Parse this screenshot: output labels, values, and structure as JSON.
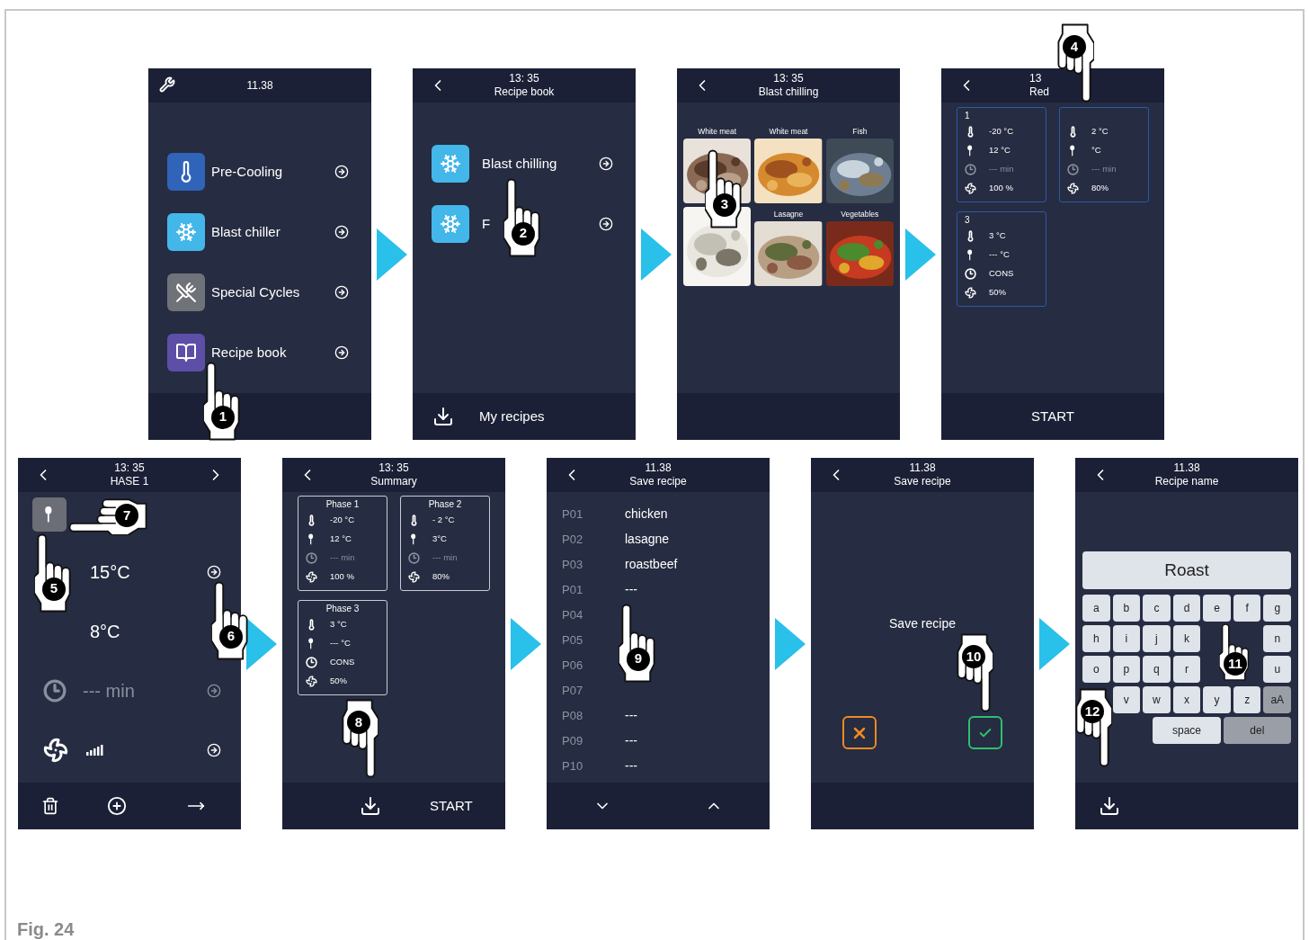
{
  "screens": [
    {
      "kind": "menu",
      "header": {
        "time": "11.38"
      },
      "items": [
        {
          "kind": "precooling",
          "label": "Pre-Cooling"
        },
        {
          "kind": "blast",
          "label": "Blast chiller"
        },
        {
          "kind": "special",
          "label": "Special Cycles"
        },
        {
          "kind": "book",
          "label": "Recipe book"
        }
      ],
      "steps": [
        {
          "number": "1",
          "kind": "up"
        }
      ]
    },
    {
      "kind": "recipe_book",
      "header": {
        "time": "13: 35",
        "title": "Recipe book"
      },
      "items": [
        {
          "kind": "blast",
          "label": "Blast chilling"
        },
        {
          "kind": "blast",
          "label": "F"
        }
      ],
      "footer": {
        "label": "My recipes"
      },
      "steps": [
        {
          "number": "2",
          "kind": "up"
        }
      ]
    },
    {
      "kind": "food_grid",
      "header": {
        "time": "13: 35",
        "title": "Blast chilling"
      },
      "tiles": [
        {
          "label": "White meat"
        },
        {
          "label": "White meat"
        },
        {
          "label": "Fish"
        },
        {
          "kind": "covered"
        },
        {
          "label": "Lasagne"
        },
        {
          "label": "Vegetables"
        }
      ],
      "steps": [
        {
          "number": "3",
          "kind": "up"
        }
      ]
    },
    {
      "kind": "phases",
      "header": {
        "time": "13",
        "title": "Red"
      },
      "cards": [
        {
          "title": "1",
          "rows": [
            {
              "kind": "temp",
              "value": "-20 °C",
              "disabled": false
            },
            {
              "kind": "probe",
              "value": "12 °C",
              "disabled": false
            },
            {
              "kind": "time",
              "value": "--- min",
              "disabled": true
            },
            {
              "kind": "fan",
              "value": "100 %",
              "disabled": false
            }
          ]
        },
        {
          "rows": [
            {
              "kind": "temp",
              "value": "2 °C",
              "disabled": false
            },
            {
              "kind": "probe",
              "value": "°C",
              "disabled": false
            },
            {
              "kind": "time",
              "value": "--- min",
              "disabled": true
            },
            {
              "kind": "fan",
              "value": "80%",
              "disabled": false
            }
          ]
        },
        {
          "title": "3",
          "rows": [
            {
              "kind": "temp",
              "value": "3 °C",
              "disabled": false
            },
            {
              "kind": "probe",
              "value": "--- °C",
              "disabled": false
            },
            {
              "kind": "time",
              "value": "CONS",
              "disabled": false
            },
            {
              "kind": "fan",
              "value": "50%",
              "disabled": false
            }
          ]
        }
      ],
      "footer": {
        "label": "START"
      },
      "steps": [
        {
          "number": "4",
          "kind": "down"
        }
      ]
    },
    {
      "kind": "phase_edit",
      "header": {
        "time": "13: 35",
        "title": "HASE 1"
      },
      "rows": [
        {
          "kind": "probe_tile",
          "selected": true
        },
        {
          "kind": "value",
          "value": "15°C",
          "arrow": true,
          "disabled": false
        },
        {
          "kind": "value",
          "value": "8°C",
          "arrow": false,
          "disabled": false
        },
        {
          "kind": "time",
          "value": "--- min",
          "arrow": true,
          "disabled": true
        },
        {
          "kind": "fan",
          "arrow": true,
          "disabled": false
        }
      ],
      "steps": [
        {
          "number": "5",
          "kind": "up"
        },
        {
          "number": "6",
          "kind": "up"
        },
        {
          "number": "7",
          "kind": "left"
        }
      ]
    },
    {
      "kind": "summary",
      "header": {
        "time": "13: 35",
        "title": "Summary"
      },
      "cards": [
        {
          "title": "Phase 1",
          "rows": [
            {
              "kind": "temp",
              "value": "-20 °C",
              "disabled": false
            },
            {
              "kind": "probe",
              "value": "12 °C",
              "disabled": false
            },
            {
              "kind": "time",
              "value": "--- min",
              "disabled": true
            },
            {
              "kind": "fan",
              "value": "100 %",
              "disabled": false
            }
          ]
        },
        {
          "title": "Phase 2",
          "rows": [
            {
              "kind": "temp",
              "value": "- 2 °C",
              "disabled": false
            },
            {
              "kind": "probe",
              "value": "3°C",
              "disabled": false
            },
            {
              "kind": "time",
              "value": "--- min",
              "disabled": true
            },
            {
              "kind": "fan",
              "value": "80%",
              "disabled": false
            }
          ]
        },
        {
          "title": "Phase 3",
          "rows": [
            {
              "kind": "temp",
              "value": "3 °C",
              "disabled": false
            },
            {
              "kind": "probe",
              "value": "--- °C",
              "disabled": false
            },
            {
              "kind": "time",
              "value": "CONS",
              "disabled": false
            },
            {
              "kind": "fan",
              "value": "50%",
              "disabled": false
            }
          ]
        }
      ],
      "footer": {
        "label": "START"
      },
      "steps": [
        {
          "number": "8",
          "kind": "down"
        }
      ]
    },
    {
      "kind": "recipe_list",
      "header": {
        "time": "11.38",
        "title": "Save recipe"
      },
      "rows": [
        {
          "code": "P01",
          "value": "chicken"
        },
        {
          "code": "P02",
          "value": "lasagne"
        },
        {
          "code": "P03",
          "value": "roastbeef"
        },
        {
          "code": "P01",
          "value": "---"
        },
        {
          "code": "P04"
        },
        {
          "code": "P05"
        },
        {
          "code": "P06"
        },
        {
          "code": "P07"
        },
        {
          "code": "P08",
          "value": "---"
        },
        {
          "code": "P09",
          "value": "---"
        },
        {
          "code": "P10",
          "value": "---"
        }
      ],
      "steps": [
        {
          "number": "9",
          "kind": "up"
        }
      ]
    },
    {
      "kind": "confirm",
      "header": {
        "time": "11.38",
        "title": "Save recipe"
      },
      "message": "Save recipe",
      "steps": [
        {
          "number": "10",
          "kind": "down"
        }
      ]
    },
    {
      "kind": "keyboard",
      "header": {
        "time": "11.38",
        "title": "Recipe name"
      },
      "field": {
        "value": "Roast"
      },
      "keys": [
        [
          {
            "kind": "letter",
            "label": "a"
          },
          {
            "kind": "letter",
            "label": "b"
          },
          {
            "kind": "letter",
            "label": "c"
          },
          {
            "kind": "letter",
            "label": "d"
          },
          {
            "kind": "letter",
            "label": "e"
          },
          {
            "kind": "letter",
            "label": "f"
          },
          {
            "kind": "letter",
            "label": "g"
          }
        ],
        [
          {
            "kind": "letter",
            "label": "h"
          },
          {
            "kind": "letter",
            "label": "i"
          },
          {
            "kind": "letter",
            "label": "j"
          },
          {
            "kind": "letter",
            "label": "k"
          },
          {
            "kind": "covered"
          },
          {
            "kind": "covered"
          },
          {
            "kind": "letter",
            "label": "n"
          }
        ],
        [
          {
            "kind": "letter",
            "label": "o"
          },
          {
            "kind": "letter",
            "label": "p"
          },
          {
            "kind": "letter",
            "label": "q"
          },
          {
            "kind": "letter",
            "label": "r"
          },
          {
            "kind": "covered"
          },
          {
            "kind": "covered"
          },
          {
            "kind": "letter",
            "label": "u"
          }
        ],
        [
          {
            "kind": "covered"
          },
          {
            "kind": "letter",
            "label": "v"
          },
          {
            "kind": "letter",
            "label": "w"
          },
          {
            "kind": "letter",
            "label": "x"
          },
          {
            "kind": "letter",
            "label": "y"
          },
          {
            "kind": "letter",
            "label": "z"
          },
          {
            "kind": "function",
            "label": "aA"
          }
        ],
        [
          {
            "kind": "covered"
          },
          {
            "kind": "letter",
            "label": "space"
          },
          {
            "kind": "function",
            "label": "del"
          }
        ]
      ],
      "steps": [
        {
          "number": "11",
          "kind": "up"
        },
        {
          "number": "12",
          "kind": "down"
        }
      ]
    }
  ],
  "caption": "Fig. 24"
}
